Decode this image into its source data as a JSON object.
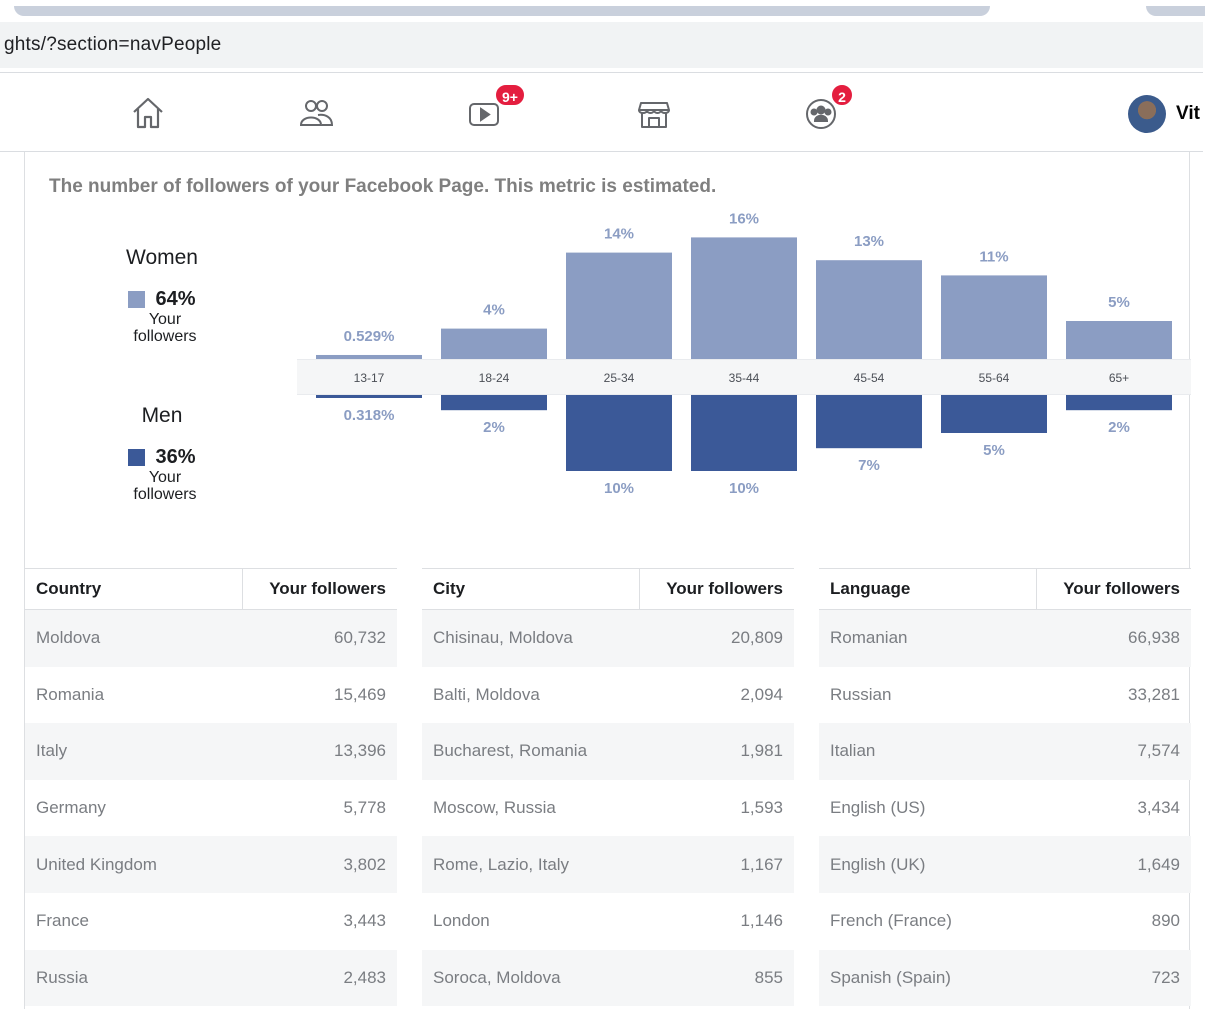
{
  "browser": {
    "url": "ghts/?section=navPeople"
  },
  "nav": {
    "items": [
      {
        "icon": "home-icon"
      },
      {
        "icon": "friends-icon"
      },
      {
        "icon": "watch-icon",
        "badge": "9+"
      },
      {
        "icon": "marketplace-icon"
      },
      {
        "icon": "groups-icon",
        "badge": "2"
      }
    ],
    "profile_name": "Vit"
  },
  "card": {
    "subtitle": "The number of followers of your Facebook Page. This metric is estimated."
  },
  "legend": {
    "women": {
      "label": "Women",
      "pct": "64%",
      "sub": "Your followers",
      "color": "#8b9dc3"
    },
    "men": {
      "label": "Men",
      "pct": "36%",
      "sub": "Your followers",
      "color": "#3b5998"
    }
  },
  "chart_data": {
    "type": "bar",
    "categories": [
      "13-17",
      "18-24",
      "25-34",
      "35-44",
      "45-54",
      "55-64",
      "65+"
    ],
    "series": [
      {
        "name": "Women",
        "values": [
          0.529,
          4,
          14,
          16,
          13,
          11,
          5
        ],
        "labels": [
          "0.529%",
          "4%",
          "14%",
          "16%",
          "13%",
          "11%",
          "5%"
        ],
        "color": "#8b9dc3"
      },
      {
        "name": "Men",
        "values": [
          0.318,
          2,
          10,
          10,
          7,
          5,
          2
        ],
        "labels": [
          "0.318%",
          "2%",
          "10%",
          "10%",
          "7%",
          "5%",
          "2%"
        ],
        "color": "#3b5998"
      }
    ]
  },
  "tables": [
    {
      "col1": "Country",
      "col2": "Your followers",
      "rows": [
        [
          "Moldova",
          "60,732"
        ],
        [
          "Romania",
          "15,469"
        ],
        [
          "Italy",
          "13,396"
        ],
        [
          "Germany",
          "5,778"
        ],
        [
          "United Kingdom",
          "3,802"
        ],
        [
          "France",
          "3,443"
        ],
        [
          "Russia",
          "2,483"
        ]
      ]
    },
    {
      "col1": "City",
      "col2": "Your followers",
      "rows": [
        [
          "Chisinau, Moldova",
          "20,809"
        ],
        [
          "Balti, Moldova",
          "2,094"
        ],
        [
          "Bucharest, Romania",
          "1,981"
        ],
        [
          "Moscow, Russia",
          "1,593"
        ],
        [
          "Rome, Lazio, Italy",
          "1,167"
        ],
        [
          "London",
          "1,146"
        ],
        [
          "Soroca, Moldova",
          "855"
        ]
      ]
    },
    {
      "col1": "Language",
      "col2": "Your followers",
      "rows": [
        [
          "Romanian",
          "66,938"
        ],
        [
          "Russian",
          "33,281"
        ],
        [
          "Italian",
          "7,574"
        ],
        [
          "English (US)",
          "3,434"
        ],
        [
          "English (UK)",
          "1,649"
        ],
        [
          "French (France)",
          "890"
        ],
        [
          "Spanish (Spain)",
          "723"
        ]
      ]
    }
  ]
}
